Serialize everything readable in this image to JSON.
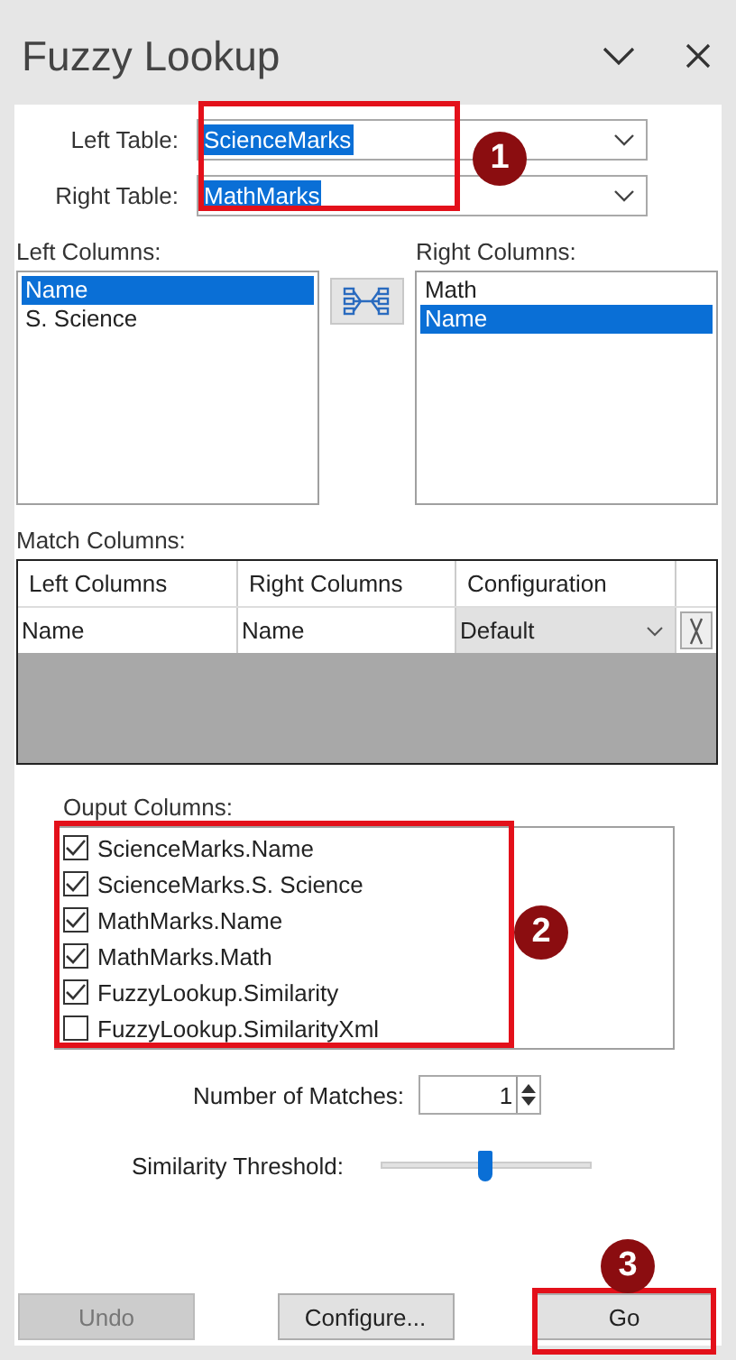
{
  "window": {
    "title": "Fuzzy Lookup"
  },
  "tables": [
    {
      "label": "Left Table:",
      "value": "ScienceMarks"
    },
    {
      "label": "Right Table:",
      "value": "MathMarks"
    }
  ],
  "left_columns": {
    "label": "Left Columns:",
    "items": [
      {
        "label": "Name",
        "selected": true
      },
      {
        "label": "S. Science",
        "selected": false
      }
    ]
  },
  "right_columns": {
    "label": "Right Columns:",
    "items": [
      {
        "label": "Math",
        "selected": false
      },
      {
        "label": "Name",
        "selected": true
      }
    ]
  },
  "match_columns": {
    "label": "Match Columns:",
    "columns": [
      "Left Columns",
      "Right Columns",
      "Configuration"
    ],
    "rows": [
      {
        "left": "Name",
        "right": "Name",
        "configuration": "Default"
      }
    ]
  },
  "output_columns": {
    "label": "Ouput Columns:",
    "items": [
      {
        "label": "ScienceMarks.Name",
        "checked": true
      },
      {
        "label": "ScienceMarks.S. Science",
        "checked": true
      },
      {
        "label": "MathMarks.Name",
        "checked": true
      },
      {
        "label": "MathMarks.Math",
        "checked": true
      },
      {
        "label": "FuzzyLookup.Similarity",
        "checked": true
      },
      {
        "label": "FuzzyLookup.SimilarityXml",
        "checked": false
      }
    ]
  },
  "number_of_matches": {
    "label": "Number of Matches:",
    "value": "1"
  },
  "similarity_threshold": {
    "label": "Similarity Threshold:",
    "level": 0.5
  },
  "buttons": [
    {
      "label": "Undo",
      "disabled": true
    },
    {
      "label": "Configure...",
      "disabled": false
    },
    {
      "label": "Go",
      "disabled": false
    }
  ],
  "callouts": [
    {
      "number": "1"
    },
    {
      "number": "2"
    },
    {
      "number": "3"
    }
  ]
}
